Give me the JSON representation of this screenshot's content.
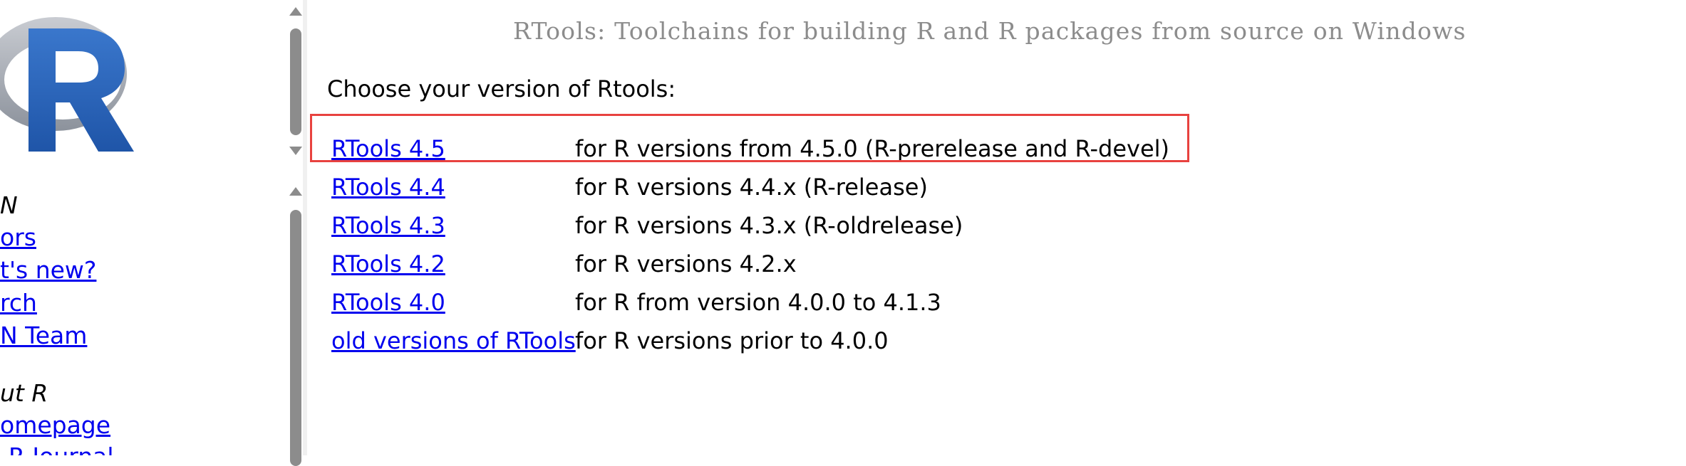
{
  "sidebar": {
    "logo_alt": "R",
    "sections": [
      {
        "heading": "CRAN",
        "visible_heading": "N"
      },
      {
        "heading": "About R",
        "visible_heading": "ut R"
      }
    ],
    "cran_links": [
      "ors",
      "t's new?",
      "rch",
      "N Team"
    ],
    "about_links": [
      "omepage",
      "R Journal"
    ]
  },
  "main": {
    "title": "RTools: Toolchains for building R and R packages from source on Windows",
    "choose_label": "Choose your version of Rtools:",
    "versions": [
      {
        "link": "RTools 4.5",
        "description": "for R versions from 4.5.0 (R-prerelease and R-devel)"
      },
      {
        "link": "RTools 4.4",
        "description": "for R versions 4.4.x (R-release)"
      },
      {
        "link": "RTools 4.3",
        "description": "for R versions 4.3.x (R-oldrelease)"
      },
      {
        "link": "RTools 4.2",
        "description": "for R versions 4.2.x"
      },
      {
        "link": "RTools 4.0",
        "description": "for R from version 4.0.0 to 4.1.3"
      },
      {
        "link": "old versions of RTools",
        "description": "for R versions prior to 4.0.0"
      }
    ],
    "highlighted_index": 0
  },
  "colors": {
    "link": "#0000ee",
    "title": "#8c8c8c",
    "highlight_border": "#e8423f",
    "logo_ring": "#9fa4ad",
    "logo_letter": "#2a64b7"
  }
}
